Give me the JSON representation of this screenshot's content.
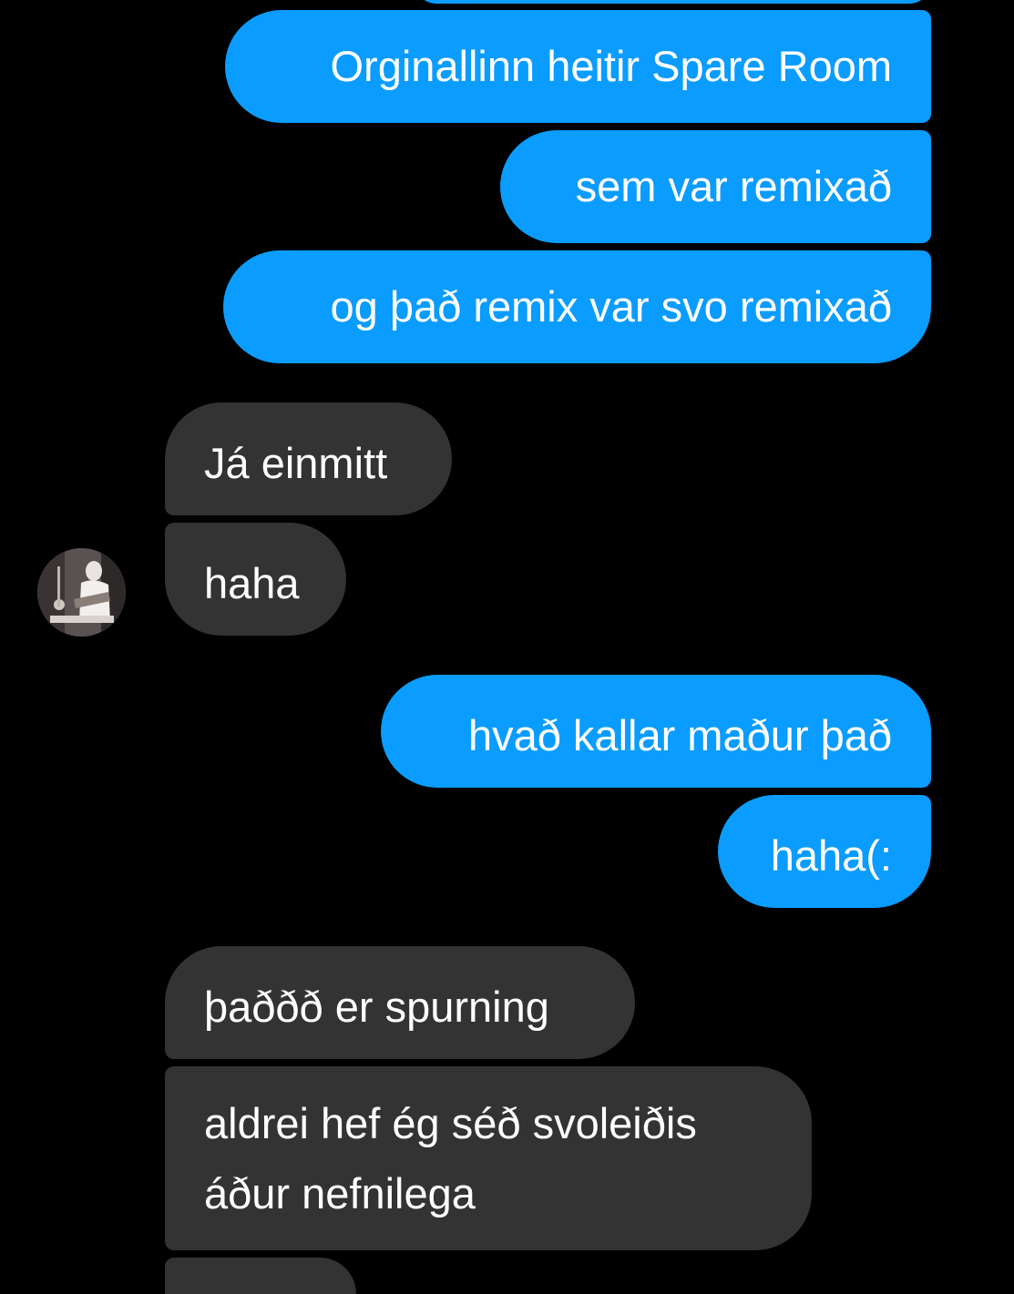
{
  "conversation": {
    "messages": [
      {
        "side": "outgoing",
        "text": "Orginallinn heitir Spare Room"
      },
      {
        "side": "outgoing",
        "text": "sem var remixað"
      },
      {
        "side": "outgoing",
        "text": "og það remix var svo remixað"
      },
      {
        "side": "incoming",
        "text": "Já einmitt"
      },
      {
        "side": "incoming",
        "text": "haha"
      },
      {
        "side": "outgoing",
        "text": "hvað kallar maður það"
      },
      {
        "side": "outgoing",
        "text": "haha(:"
      },
      {
        "side": "incoming",
        "text": "þaððð er spurning"
      },
      {
        "side": "incoming",
        "lines": [
          "aldrei hef ég séð svoleiðis",
          "áður nefnilega"
        ]
      }
    ],
    "contact": {
      "avatar_icon": "contact-avatar-photo"
    }
  },
  "colors": {
    "background": "#000000",
    "outgoing_bubble": "#0a9cff",
    "incoming_bubble": "#333333",
    "text": "#ffffff"
  }
}
